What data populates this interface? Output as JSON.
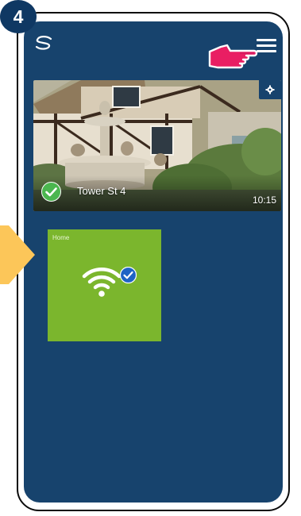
{
  "step": {
    "number": "4"
  },
  "header": {
    "logo_icon": "app-logo-icon",
    "menu_icon": "hamburger-menu-icon",
    "pointer_icon": "pointing-hand-icon"
  },
  "location": {
    "name": "Tower St 4",
    "time": "10:15",
    "status_icon": "check-circle-icon",
    "settings_icon": "gear-icon"
  },
  "device": {
    "label": "Home",
    "icon": "wifi-icon",
    "status_icon": "verified-check-icon"
  },
  "colors": {
    "screen_background": "#17436d",
    "device_tile": "#7bb62d",
    "step_badge": "#0f3863",
    "pointer_hand": "#e91e63",
    "side_arrow": "#fcc659",
    "check_green": "#4bb64f",
    "verified_blue": "#1e63c5"
  }
}
